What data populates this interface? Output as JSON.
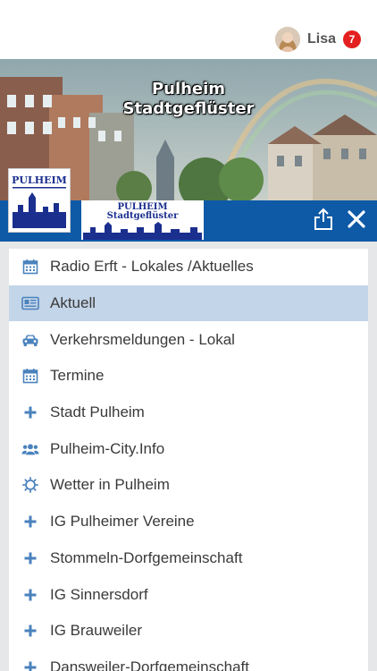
{
  "user": {
    "name": "Lisa",
    "notifications": "7"
  },
  "banner": {
    "title_line1": "Pulheim",
    "title_line2": "Stadtgeflüster"
  },
  "logos": {
    "small_text": "PULHEIM",
    "big_text_line1": "PULHEIM",
    "big_text_line2": "Stadtgeflüster"
  },
  "colors": {
    "primary": "#0e5aa7",
    "active_row": "#c3d5e8",
    "icon": "#4a82bd",
    "badge": "#e3201f"
  },
  "menu": {
    "items": [
      {
        "label": "Radio Erft - Lokales /Aktuelles",
        "icon": "calendar-icon"
      },
      {
        "label": "Aktuell",
        "icon": "newspaper-icon"
      },
      {
        "label": "Verkehrsmeldungen - Lokal",
        "icon": "car-icon"
      },
      {
        "label": "Termine",
        "icon": "calendar-icon"
      },
      {
        "label": "Stadt Pulheim",
        "icon": "plus-icon"
      },
      {
        "label": "Pulheim-City.Info",
        "icon": "users-icon"
      },
      {
        "label": "Wetter in Pulheim",
        "icon": "sun-icon"
      },
      {
        "label": "IG Pulheimer Vereine",
        "icon": "plus-icon"
      },
      {
        "label": "Stommeln-Dorfgemeinschaft",
        "icon": "plus-icon"
      },
      {
        "label": "IG Sinnersdorf",
        "icon": "plus-icon"
      },
      {
        "label": "IG Brauweiler",
        "icon": "plus-icon"
      },
      {
        "label": "Dansweiler-Dorfgemeinschaft",
        "icon": "plus-icon"
      }
    ]
  }
}
